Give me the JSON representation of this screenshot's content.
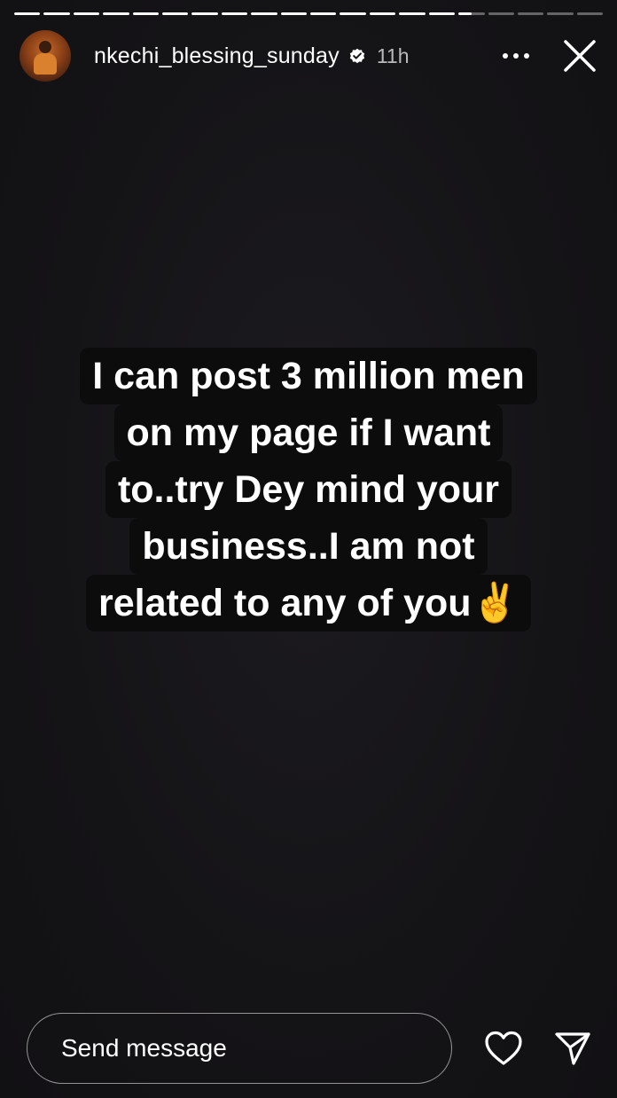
{
  "story": {
    "progress": [
      {
        "fill": 1.0
      },
      {
        "fill": 1.0
      },
      {
        "fill": 1.0
      },
      {
        "fill": 1.0
      },
      {
        "fill": 1.0
      },
      {
        "fill": 1.0
      },
      {
        "fill": 1.0
      },
      {
        "fill": 1.0
      },
      {
        "fill": 1.0
      },
      {
        "fill": 1.0
      },
      {
        "fill": 1.0
      },
      {
        "fill": 1.0
      },
      {
        "fill": 1.0
      },
      {
        "fill": 1.0
      },
      {
        "fill": 1.0
      },
      {
        "fill": 0.5
      },
      {
        "fill": 0.0
      },
      {
        "fill": 0.0
      },
      {
        "fill": 0.0
      },
      {
        "fill": 0.0
      }
    ]
  },
  "header": {
    "username": "nkechi_blessing_sunday",
    "verified_icon": "verified-badge-icon",
    "time_ago": "11h",
    "more_icon": "more-horizontal-icon",
    "close_icon": "close-icon"
  },
  "caption": {
    "lines": [
      "I can post 3 million men",
      "on my page if I want",
      "to..try Dey mind your",
      "business..I am not",
      "related to any of you✌️"
    ]
  },
  "footer": {
    "message_placeholder": "Send message",
    "like_icon": "heart-icon",
    "share_icon": "send-icon"
  },
  "colors": {
    "background": "#151417",
    "text": "#ffffff",
    "caption_bg": "#0c0c0d"
  }
}
